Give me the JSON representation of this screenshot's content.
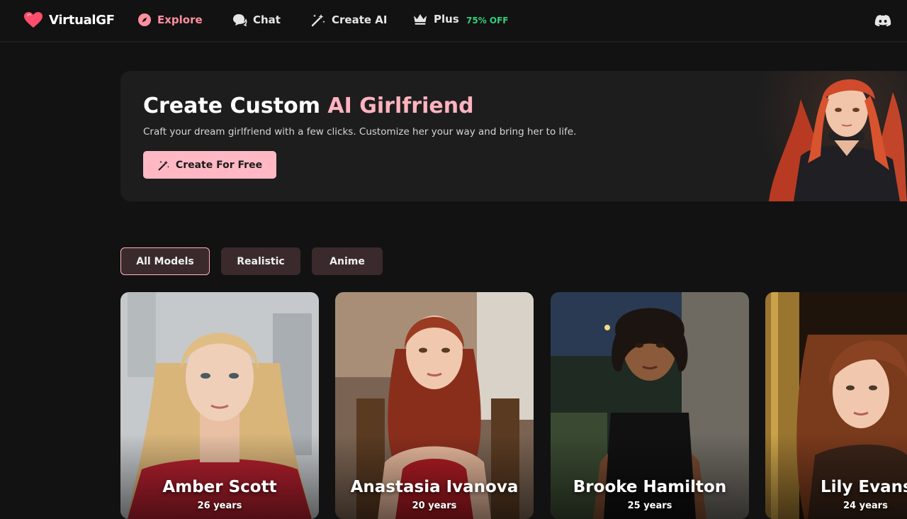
{
  "brand": {
    "name": "VirtualGF",
    "logo_icon": "heart-icon",
    "color": "#ff4d6d"
  },
  "nav": {
    "explore": "Explore",
    "chat": "Chat",
    "create_ai": "Create AI",
    "plus": "Plus",
    "plus_badge": "75% OFF"
  },
  "hero": {
    "title_main": "Create Custom ",
    "title_accent": "AI Girlfriend",
    "subtitle": "Craft your dream girlfriend with a few clicks. Customize her your way and bring her to life.",
    "button_label": "Create For Free"
  },
  "filters": [
    "All Models",
    "Realistic",
    "Anime"
  ],
  "active_filter": "All Models",
  "models": [
    {
      "name": "Amber Scott",
      "age": "26 years",
      "hair": "#d9b57a",
      "bg": "#bfc3c4",
      "outfit": "#b5202e"
    },
    {
      "name": "Anastasia Ivanova",
      "age": "20 years",
      "hair": "#8a2e1c",
      "bg": "#6b5544",
      "outfit": "#b01c24"
    },
    {
      "name": "Brooke Hamilton",
      "age": "25 years",
      "hair": "#1c1410",
      "bg": "#2c3a2e",
      "outfit": "#111111"
    },
    {
      "name": "Lily Evans",
      "age": "24 years",
      "hair": "#7a3a1c",
      "bg": "#2a1c12",
      "outfit": "#3a2418"
    }
  ],
  "colors": {
    "accent": "#ffb3bf",
    "badge_green": "#35d07f",
    "background": "#121212"
  }
}
